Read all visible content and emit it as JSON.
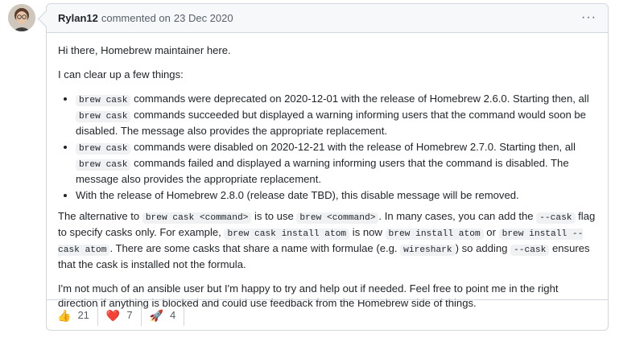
{
  "comment": {
    "author": "Rylan12",
    "verb": "commented on",
    "date": "23 Dec 2020",
    "menu_label": "···"
  },
  "body": {
    "intro": "Hi there, Homebrew maintainer here.",
    "lead": "I can clear up a few things:",
    "bullets": [
      {
        "code1": "brew cask",
        "text1": " commands were deprecated on 2020-12-01 with the release of Homebrew 2.6.0. Starting then, all ",
        "code2": "brew cask",
        "text2": " commands succeeded but displayed a warning informing users that the command would soon be disabled. The message also provides the appropriate replacement."
      },
      {
        "code1": "brew cask",
        "text1": " commands were disabled on 2020-12-21 with the release of Homebrew 2.7.0. Starting then, all ",
        "code2": "brew cask",
        "text2": " commands failed and displayed a warning informing users that the command is disabled. The message also provides the appropriate replacement."
      },
      {
        "text": "With the release of Homebrew 2.8.0 (release date TBD), this disable message will be removed."
      }
    ],
    "alt": {
      "t1": "The alternative to ",
      "c1": "brew cask <command>",
      "t2": " is to use ",
      "c2": "brew <command>",
      "t3": ". In many cases, you can add the ",
      "c3": "--cask",
      "t4": " flag to specify casks only. For example, ",
      "c4": "brew cask install atom",
      "t5": " is now ",
      "c5": "brew install atom",
      "t6": " or ",
      "c6": "brew install --cask atom",
      "t7": ". There are some casks that share a name with formulae (e.g. ",
      "c7": "wireshark",
      "t8": ") so adding ",
      "c8": "--cask",
      "t9": " ensures that the cask is installed not the formula."
    },
    "closing": "I'm not much of an ansible user but I'm happy to try and help out if needed. Feel free to point me in the right direction if anything is blocked and could use feedback from the Homebrew side of things."
  },
  "reactions": [
    {
      "emoji": "👍",
      "icon": "thumbs-up-icon",
      "count": "21"
    },
    {
      "emoji": "❤️",
      "icon": "heart-icon",
      "count": "7"
    },
    {
      "emoji": "🚀",
      "icon": "rocket-icon",
      "count": "4"
    }
  ]
}
